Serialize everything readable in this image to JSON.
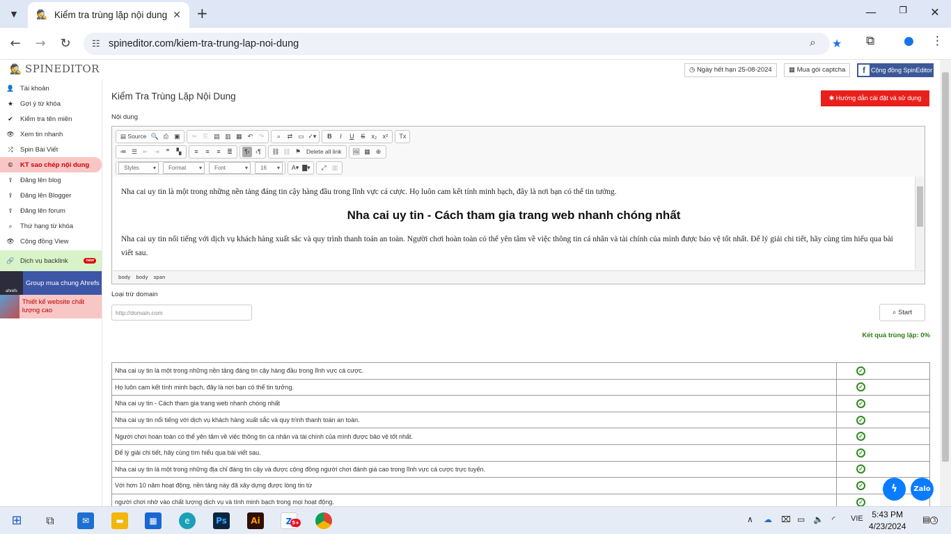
{
  "browser": {
    "tab_title": "Kiểm tra trùng lặp nội dung",
    "url": "spineditor.com/kiem-tra-trung-lap-noi-dung"
  },
  "header": {
    "brand": "SPINEDITOR",
    "expiry": "Ngày hết hạn 25-08-2024",
    "captcha": "Mua gói captcha",
    "community": "Cộng đồng SpinEditor"
  },
  "sidebar": {
    "items": [
      {
        "label": "Tài khoản",
        "icon": "user-icon",
        "glyph": "👤"
      },
      {
        "label": "Gợi ý từ khóa",
        "icon": "star-icon",
        "glyph": "★"
      },
      {
        "label": "Kiểm tra tên miền",
        "icon": "check-icon",
        "glyph": "✔"
      },
      {
        "label": "Xem tin nhanh",
        "icon": "eye-icon",
        "glyph": "👁"
      },
      {
        "label": "Spin Bài Viết",
        "icon": "shuffle-icon",
        "glyph": "⤮"
      },
      {
        "label": "KT sao chép nội dung",
        "icon": "copyright-icon",
        "glyph": "©",
        "active": true
      },
      {
        "label": "Đăng lên blog",
        "icon": "upload-icon",
        "glyph": "⇪"
      },
      {
        "label": "Đăng lên Blogger",
        "icon": "upload-icon",
        "glyph": "⇪"
      },
      {
        "label": "Đăng lên forum",
        "icon": "upload-icon",
        "glyph": "⇪"
      },
      {
        "label": "Thứ hạng từ khóa",
        "icon": "search-icon",
        "glyph": "⌕"
      },
      {
        "label": "Cộng đồng View",
        "icon": "eye-icon",
        "glyph": "👁"
      }
    ],
    "backlink": {
      "label": "Dịch vụ backlink",
      "badge": "new"
    },
    "ahrefs": {
      "label": "Group mua chung Ahrefs",
      "img_text": "ahrefs"
    },
    "website": {
      "label": "Thiết kế website chất lượng cao"
    }
  },
  "main": {
    "title": "Kiểm Tra Trùng Lặp Nội Dung",
    "guide_button": "Hướng dẫn cài đặt và sử dụng",
    "content_label": "Nội dung",
    "toolbar": {
      "source": "Source",
      "delete_links": "Delete all link",
      "styles": "Styles",
      "format": "Format",
      "font": "Font",
      "size": "16"
    },
    "editor": {
      "p1": "Nha cai uy tin là một trong những nền tảng đáng tin cậy hàng đầu trong lĩnh vực cá cược. Họ luôn cam kết tính minh bạch, đây là nơi bạn có thể tin tưởng.",
      "h2": "Nha cai uy tin - Cách tham gia trang web nhanh chóng nhất",
      "p2": "Nha cai uy tin nổi tiếng với dịch vụ khách hàng xuất sắc và quy trình thanh toán an toàn. Người chơi hoàn toàn có thể yên tâm về việc thông tin cá nhân và tài chính của mình được bảo vệ tốt nhất. Để lý giải chi tiết, hãy cùng tìm hiểu qua bài viết sau.",
      "path": [
        "body",
        "body",
        "span"
      ]
    },
    "exclude_label": "Loại trừ domain",
    "domain_placeholder": "http://domain.com",
    "start_button": "Start",
    "result": "Kết quả trùng lặp: 0%",
    "rows": [
      "Nha cai uy tin là một trong những nền tảng đáng tin cậy hàng đầu trong lĩnh vực cá cược.",
      "Họ luôn cam kết tính minh bạch, đây là nơi bạn có thể tin tưởng.",
      "Nha cai uy tin - Cách tham gia trang web nhanh chóng nhất",
      "Nha cai uy tin nổi tiếng với dịch vụ khách hàng xuất sắc và quy trình thanh toán an toàn.",
      "Người chơi hoàn toàn có thể yên tâm về việc thông tin cá nhân và tài chính của mình được bảo vệ tốt nhất.",
      "Để lý giải chi tiết, hãy cùng tìm hiểu qua bài viết sau.",
      "Nha cai uy tin là một trong những địa chỉ đáng tin cậy và được cộng đồng người chơi đánh giá cao trong lĩnh vực cá cược trực tuyến.",
      "Với hơn 10 năm hoạt động, nền tảng này đã xây dựng được lòng tin từ",
      "người chơi nhờ vào chất lượng dịch vụ và tính minh bạch trong mọi hoạt động."
    ]
  },
  "taskbar": {
    "lang": "VIE",
    "time": "5:43 PM",
    "date": "4/23/2024",
    "notifications": "3",
    "zalo_badge": "5+"
  },
  "colors": {
    "accent_red": "#e8201c",
    "fb_blue": "#3b5998",
    "ok_green": "#2e8b1e"
  }
}
